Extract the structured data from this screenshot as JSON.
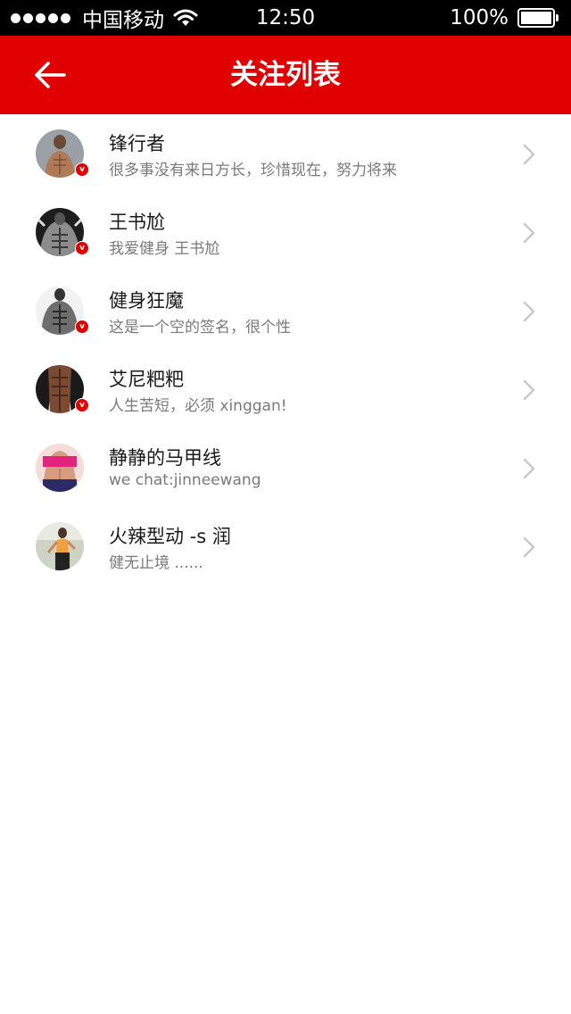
{
  "status_bar": {
    "carrier": "中国移动",
    "time": "12:50",
    "battery": "100%",
    "battery_level": 1.0
  },
  "nav": {
    "title": "关注列表",
    "back_icon": "arrow-left-icon"
  },
  "colors": {
    "brand_red": "#e00000",
    "status_bar": "#000000",
    "name_text": "#1a1a1a",
    "signature_text": "#7a7a7a"
  },
  "follow_list": [
    {
      "name": "锋行者",
      "signature": "很多事没有来日方长，珍惜现在，努力将来",
      "verified": true,
      "verified_mark": "v"
    },
    {
      "name": "王书尬",
      "signature": "我爱健身 王书尬",
      "verified": true,
      "verified_mark": "v"
    },
    {
      "name": "健身狂魔",
      "signature": "这是一个空的签名，很个性",
      "verified": true,
      "verified_mark": "v"
    },
    {
      "name": "艾尼粑粑",
      "signature": "人生苦短，必须 xinggan!",
      "verified": true,
      "verified_mark": "v"
    },
    {
      "name": "静静的马甲线",
      "signature": "we chat:jinneewang",
      "verified": false
    },
    {
      "name": "火辣型动 -s 润",
      "signature": "健无止境 ......",
      "verified": false
    }
  ]
}
